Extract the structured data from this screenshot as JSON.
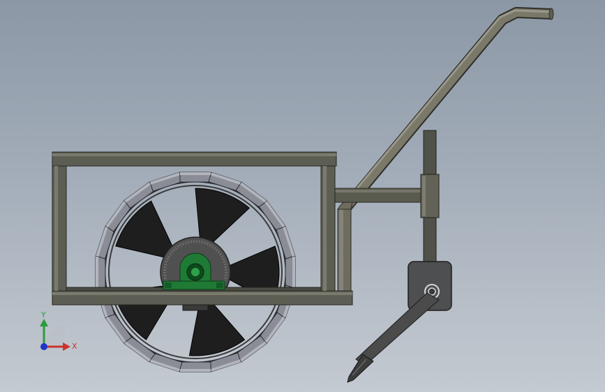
{
  "viewport": {
    "background_top": "#8c97a6",
    "background_bottom": "#c4cad1"
  },
  "model": {
    "colors": {
      "frame": "#5a5b4f",
      "frame_edge": "#2a2b25",
      "tube": "#77766a",
      "blade": "#1f1f1f",
      "paddle": "#8a8c96",
      "bearing": "#1f7a35",
      "bearing_dark": "#0d4a1c",
      "plate": "#505152"
    },
    "wheel_paddle_count": 20,
    "wheel_blade_count": 5
  },
  "triad": {
    "y_label": "Y",
    "x_label": "X",
    "y_color": "#2e9b3d",
    "x_color": "#c8342c",
    "z_color": "#2136c8"
  }
}
